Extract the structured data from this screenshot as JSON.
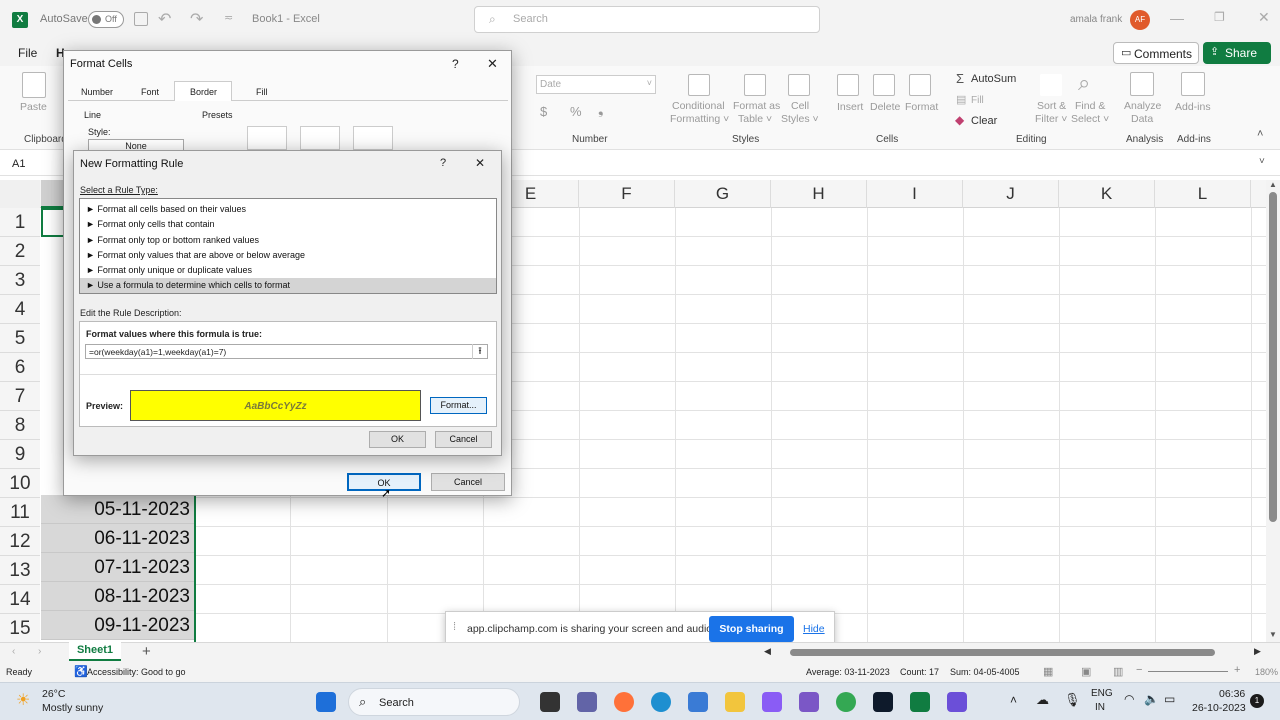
{
  "titlebar": {
    "autosave_label": "AutoSave",
    "autosave_state": "Off",
    "doc_title": "Book1 - Excel",
    "search_placeholder": "Search",
    "user_name": "amala frank",
    "user_initials": "AF"
  },
  "ribbon_tabs": {
    "file": "File",
    "home": "H",
    "comments": "Comments",
    "share": "Share"
  },
  "ribbon": {
    "paste": "Paste",
    "clipboard": "Clipboard",
    "number_format": "Date",
    "number_group": "Number",
    "conditional_formatting": [
      "Conditional",
      "Formatting ˅"
    ],
    "format_as_table": [
      "Format as",
      "Table ˅"
    ],
    "cell_styles": [
      "Cell",
      "Styles ˅"
    ],
    "styles_group": "Styles",
    "insert": "Insert",
    "delete": "Delete",
    "format": "Format",
    "cells_group": "Cells",
    "autosum": "AutoSum",
    "fill": "Fill",
    "clear": "Clear",
    "sort_filter": [
      "Sort &",
      "Filter ˅"
    ],
    "find_select": [
      "Find &",
      "Select ˅"
    ],
    "editing_group": "Editing",
    "analyze_data": [
      "Analyze",
      "Data"
    ],
    "analysis_group": "Analysis",
    "addins": "Add-ins",
    "addins_group": "Add-ins"
  },
  "formula_bar": {
    "name_box": "A1"
  },
  "grid": {
    "columns": [
      "E",
      "F",
      "G",
      "H",
      "I",
      "J",
      "K",
      "L"
    ],
    "rows": [
      "1",
      "2",
      "3",
      "4",
      "5",
      "6",
      "7",
      "8",
      "9",
      "10",
      "11",
      "12",
      "13",
      "14",
      "15"
    ],
    "visible_dates": [
      {
        "row": "11",
        "value": "05-11-2023"
      },
      {
        "row": "12",
        "value": "06-11-2023"
      },
      {
        "row": "13",
        "value": "07-11-2023"
      },
      {
        "row": "14",
        "value": "08-11-2023"
      },
      {
        "row": "15",
        "value": "09-11-2023"
      }
    ]
  },
  "format_cells": {
    "title": "Format Cells",
    "help": "?",
    "close": "✕",
    "tabs": [
      "Number",
      "Font",
      "Border",
      "Fill"
    ],
    "active_tab": "Border",
    "line_label": "Line",
    "style_label": "Style:",
    "style_value": "None",
    "presets_label": "Presets",
    "ok": "OK",
    "cancel": "Cancel"
  },
  "new_rule": {
    "title": "New Formatting Rule",
    "help": "?",
    "close": "✕",
    "select_type_label": "Select a Rule Type:",
    "rule_types": [
      "► Format all cells based on their values",
      "► Format only cells that contain",
      "► Format only top or bottom ranked values",
      "► Format only values that are above or below average",
      "► Format only unique or duplicate values",
      "► Use a formula to determine which cells to format"
    ],
    "selected_rule_index": 5,
    "edit_desc_label": "Edit the Rule Description:",
    "formula_label": "Format values where this formula is true:",
    "formula_value": "=or(weekday(a1)=1,weekday(a1)=7)",
    "preview_label": "Preview:",
    "preview_text": "AaBbCcYyZz",
    "preview_fill": "#ffff00",
    "format_button": "Format...",
    "ok": "OK",
    "cancel": "Cancel"
  },
  "sheets": {
    "active": "Sheet1",
    "add": "+"
  },
  "status": {
    "ready": "Ready",
    "accessibility": "Accessibility: Good to go",
    "average": "Average: 03-11-2023",
    "count": "Count: 17",
    "sum": "Sum: 04-05-4005",
    "zoom": "180%"
  },
  "share_banner": {
    "message": "app.clipchamp.com is sharing your screen and audio.",
    "stop": "Stop sharing",
    "hide": "Hide"
  },
  "taskbar": {
    "temp": "26°C",
    "weather": "Mostly sunny",
    "search": "Search",
    "lang": "ENG",
    "region": "IN",
    "time": "06:36",
    "date": "26-10-2023",
    "notifications": "1"
  },
  "colors": {
    "excel_green": "#107c41",
    "share_button": "#107c41",
    "stop_sharing": "#1a73e8",
    "preview_yellow": "#ffff00"
  }
}
